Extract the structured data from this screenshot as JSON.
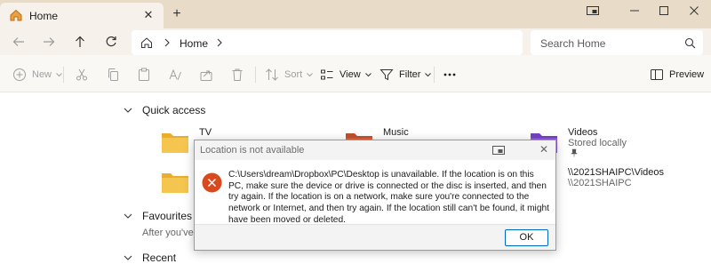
{
  "titlebar": {
    "tab_label": "Home",
    "window_buttons": [
      "compact-overlay-icon",
      "minimize-icon",
      "maximize-icon",
      "close-icon"
    ]
  },
  "navbar": {
    "breadcrumb": "Home",
    "search_placeholder": "Search Home"
  },
  "commandbar": {
    "new_label": "New",
    "sort_label": "Sort",
    "view_label": "View",
    "filter_label": "Filter",
    "preview_label": "Preview"
  },
  "content": {
    "quick_access": {
      "header": "Quick access",
      "items": [
        {
          "name": "TV",
          "sub": ""
        },
        {
          "name": "Music",
          "sub": ""
        },
        {
          "name": "Videos",
          "sub": "Stored locally"
        },
        {
          "name": "",
          "sub": ""
        },
        {
          "name": "\\\\2021SHAIPC\\Videos",
          "sub": "\\\\2021SHAIPC"
        }
      ]
    },
    "favourites": {
      "header": "Favourites",
      "sub": "After you've"
    },
    "recent": {
      "header": "Recent"
    }
  },
  "dialog": {
    "title": "Location is not available",
    "message": "C:\\Users\\dream\\Dropbox\\PC\\Desktop is unavailable. If the location is on this PC, make sure the device or drive is connected or the disc is inserted, and then try again. If the location is on a network, make sure you're connected to the network or Internet, and then try again. If the location still can't be found, it might have been moved or deleted.",
    "ok_label": "OK"
  },
  "colors": {
    "folder_yellow": "#f4c64f",
    "folder_music": "#d9623e",
    "folder_videos": "#8d5ad6",
    "error_red": "#d84a1e",
    "accent_blue": "#0067c0"
  }
}
